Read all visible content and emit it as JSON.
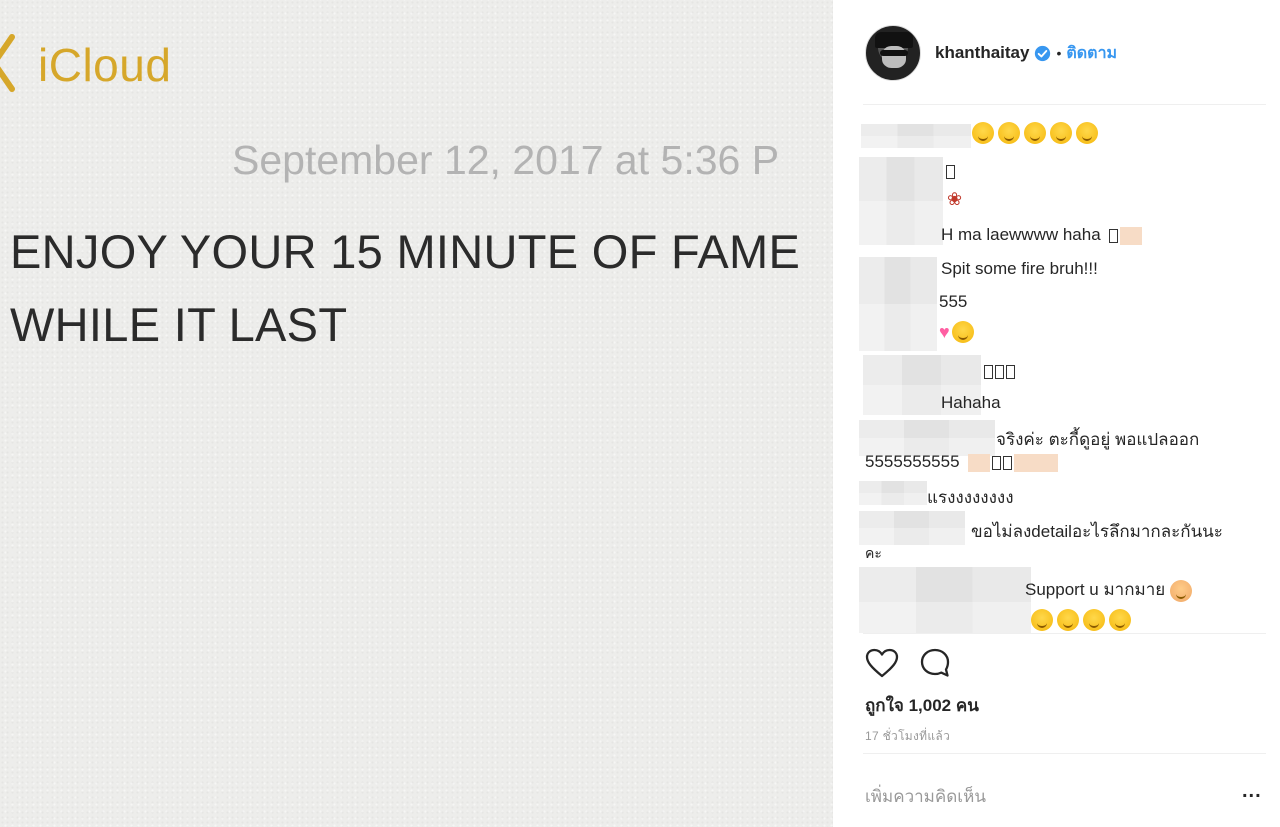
{
  "notes": {
    "back_label": "iCloud",
    "date": "September 12, 2017 at 5:36 P",
    "body_lines": [
      "ENJOY YOUR 15 MINUTE OF FAME",
      "WHILE IT LAST"
    ],
    "accent_color": "#d6a72a"
  },
  "instagram": {
    "username": "khanthaitay",
    "separator": "•",
    "follow_label": "ติดตาม",
    "comments": [
      {
        "text": ""
      },
      {
        "text": "H ma laewwww haha"
      },
      {
        "text": "Spit some fire bruh!!!"
      },
      {
        "text": "555"
      },
      {
        "text": "Hahaha"
      },
      {
        "text": "จริงค่ะ ตะกี้ดูอยู่ พอแปลออก"
      },
      {
        "text": "5555555555"
      },
      {
        "text": "แรงงงงงงงง"
      },
      {
        "text": "ขอไม่ลงdetailอะไรลึกมากละกันนะ"
      },
      {
        "text": "คะ"
      },
      {
        "text": "Support u มากมาย"
      }
    ],
    "likes_text": "ถูกใจ 1,002 คน",
    "time_text": "17 ชั่วโมงที่แล้ว",
    "add_comment_placeholder": "เพิ่มความคิดเห็น",
    "more_label": "...",
    "icons": [
      "heart-icon",
      "comment-icon",
      "verified-badge-icon",
      "more-options-icon"
    ],
    "link_color": "#3897f0"
  }
}
